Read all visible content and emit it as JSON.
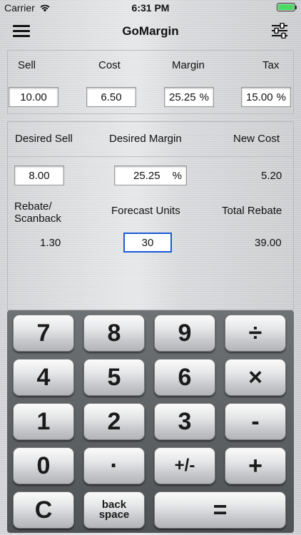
{
  "status": {
    "carrier": "Carrier",
    "time": "6:31 PM"
  },
  "nav": {
    "title": "GoMargin"
  },
  "top": {
    "headers": {
      "sell": "Sell",
      "cost": "Cost",
      "margin": "Margin",
      "tax": "Tax"
    },
    "sell": "10.00",
    "cost": "6.50",
    "margin": "25.25",
    "tax": "15.00",
    "pct": "%"
  },
  "desired": {
    "headers": {
      "sell": "Desired Sell",
      "margin": "Desired Margin",
      "new_cost": "New Cost"
    },
    "sell": "8.00",
    "margin": "25.25",
    "new_cost": "5.20",
    "pct": "%"
  },
  "rebate": {
    "label_line1": "Rebate/",
    "label_line2": "Scanback",
    "forecast_label": "Forecast Units",
    "total_label": "Total Rebate",
    "rebate_value": "1.30",
    "units": "30",
    "total_value": "39.00"
  },
  "keypad": {
    "k7": "7",
    "k8": "8",
    "k9": "9",
    "div": "÷",
    "k4": "4",
    "k5": "5",
    "k6": "6",
    "mul": "×",
    "k1": "1",
    "k2": "2",
    "k3": "3",
    "sub": "-",
    "k0": "0",
    "dot": "·",
    "neg": "+/-",
    "add": "+",
    "clear": "C",
    "back1": "back",
    "back2": "space",
    "eq": "="
  }
}
